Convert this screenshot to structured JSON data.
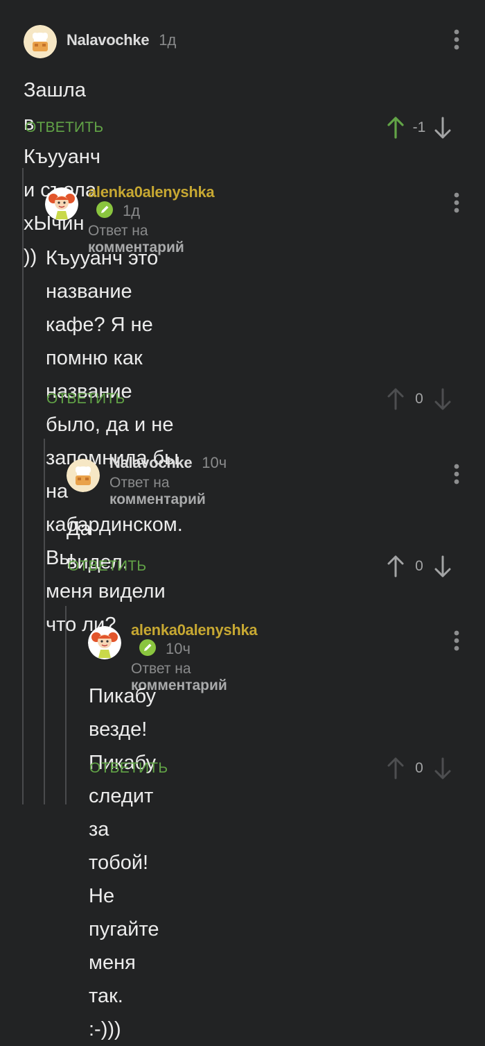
{
  "comments": [
    {
      "author": "Nalavochke",
      "time": "1д",
      "reply_to_prefix": "",
      "reply_to_link": "",
      "text": "Зашла в Къууанч и съела хЫчин ))",
      "reply_label": "ОТВЕТИТЬ",
      "score": "-1",
      "upvoted": true
    },
    {
      "author": "alenka0alenyshka",
      "time": "1д",
      "reply_to_prefix": "Ответ на",
      "reply_to_link": "комментарий",
      "text_lines": [
        "Къууанч это название кафе? Я не",
        "помню как название было, да и не",
        "запомнила бы на кабардинском. Вы",
        "меня видели что ли?"
      ],
      "reply_label": "ОТВЕТИТЬ",
      "score": "0",
      "upvoted": false
    },
    {
      "author": "Nalavochke",
      "time": "10ч",
      "reply_to_prefix": "Ответ на",
      "reply_to_link": "комментарий",
      "text": "Да видел.",
      "reply_label": "ОТВЕТИТЬ",
      "score": "0",
      "upvoted": false
    },
    {
      "author": "alenka0alenyshka",
      "time": "10ч",
      "reply_to_prefix": "Ответ на",
      "reply_to_link": "комментарий",
      "text_lines": [
        "Пикабу везде! Пикабу следит за",
        "тобой! Не пугайте меня так. :-)))"
      ],
      "reply_label": "ОТВЕТИТЬ",
      "score": "0",
      "upvoted": false
    }
  ],
  "icons": {
    "avatar_nalavochke": "chef-hat-avatar-icon",
    "avatar_alenka": "girl-avatar-icon",
    "verified": "pencil-badge-icon",
    "upvote": "arrow-up-icon",
    "downvote": "arrow-down-icon",
    "menu": "more-vertical-icon"
  },
  "colors": {
    "background": "#222324",
    "reply_green": "#62a447",
    "upvote_active": "#62a447",
    "author_gold": "#c7a832",
    "badge_green": "#8ac53f"
  }
}
